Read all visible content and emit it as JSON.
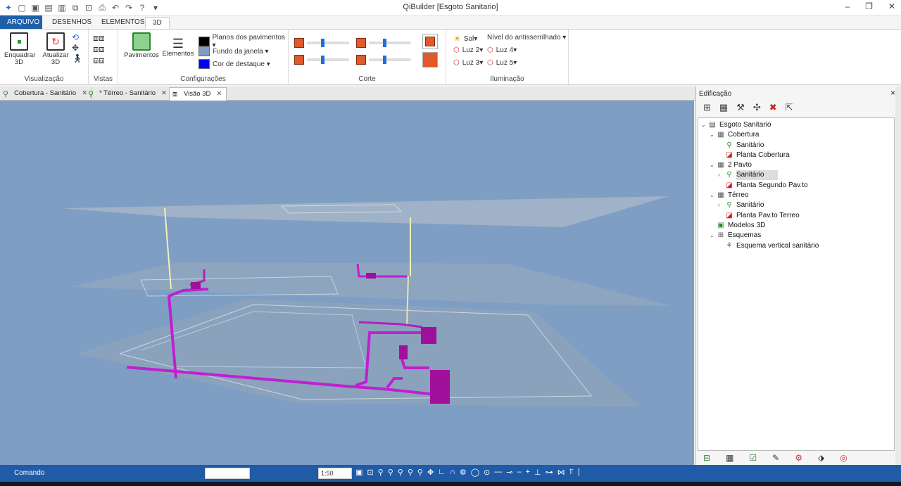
{
  "window": {
    "title": "QiBuilder [Esgoto Sanitario]",
    "minimize": "–",
    "restore": "❐",
    "close": "✕"
  },
  "ribbon_tabs": [
    {
      "label": "ARQUIVO"
    },
    {
      "label": "DESENHOS"
    },
    {
      "label": "ELEMENTOS"
    },
    {
      "label": "3D"
    }
  ],
  "ribbon": {
    "visualizacao": {
      "label": "Visualização",
      "enquadrar": "Enquadrar 3D",
      "atualizar": "Atualizar 3D"
    },
    "vistas": {
      "label": "Vistas"
    },
    "configuracoes": {
      "label": "Configurações",
      "pavimentos": "Pavimentos",
      "elementos": "Elementos",
      "planos": "Planos dos pavimentos ▾",
      "fundo": "Fundo da janela ▾",
      "destaque": "Cor de destaque ▾",
      "colors": {
        "planos": "#000000",
        "fundo": "#7f9ec4",
        "destaque": "#0000ff"
      }
    },
    "corte": {
      "label": "Corte"
    },
    "iluminacao": {
      "label": "Iluminação",
      "sol": "Sol▾",
      "antisserrilhado": "Nível do antisserrilhado ▾",
      "luz2": "Luz 2▾",
      "luz3": "Luz 3▾",
      "luz4": "Luz 4▾",
      "luz5": "Luz 5▾"
    }
  },
  "doc_tabs": [
    {
      "label": "Cobertura - Sanitário"
    },
    {
      "label": "* Térreo - Sanitário"
    },
    {
      "label": "Visão 3D"
    }
  ],
  "panel": {
    "title": "Edificação",
    "close": "×",
    "tree": [
      {
        "label": "Esgoto Sanitario",
        "level": 0,
        "twisty": "⌄",
        "icon": "project-icon"
      },
      {
        "label": "Cobertura",
        "level": 1,
        "twisty": "⌄",
        "icon": "floor-icon"
      },
      {
        "label": "Sanitário",
        "level": 2,
        "twisty": "",
        "icon": "sanitary-icon"
      },
      {
        "label": "Planta Cobertura",
        "level": 2,
        "twisty": "",
        "icon": "plan-icon"
      },
      {
        "label": "2 Pavto",
        "level": 1,
        "twisty": "⌄",
        "icon": "floor-icon"
      },
      {
        "label": "Sanitário",
        "level": 2,
        "twisty": "›",
        "icon": "sanitary-icon",
        "selected": true
      },
      {
        "label": "Planta Segundo Pav.to",
        "level": 2,
        "twisty": "",
        "icon": "plan-icon"
      },
      {
        "label": "Térreo",
        "level": 1,
        "twisty": "⌄",
        "icon": "floor-icon"
      },
      {
        "label": "Sanitário",
        "level": 2,
        "twisty": "›",
        "icon": "sanitary-icon"
      },
      {
        "label": "Planta Pav.to Terreo",
        "level": 2,
        "twisty": "",
        "icon": "plan-icon"
      },
      {
        "label": "Modelos 3D",
        "level": 1,
        "twisty": "",
        "icon": "model3d-icon"
      },
      {
        "label": "Esquemas",
        "level": 1,
        "twisty": "⌄",
        "icon": "schema-icon"
      },
      {
        "label": "Esquema vertical sanitário",
        "level": 2,
        "twisty": "",
        "icon": "vertical-schema-icon"
      }
    ]
  },
  "status": {
    "command_label": "Comando",
    "scale": "1:50"
  }
}
